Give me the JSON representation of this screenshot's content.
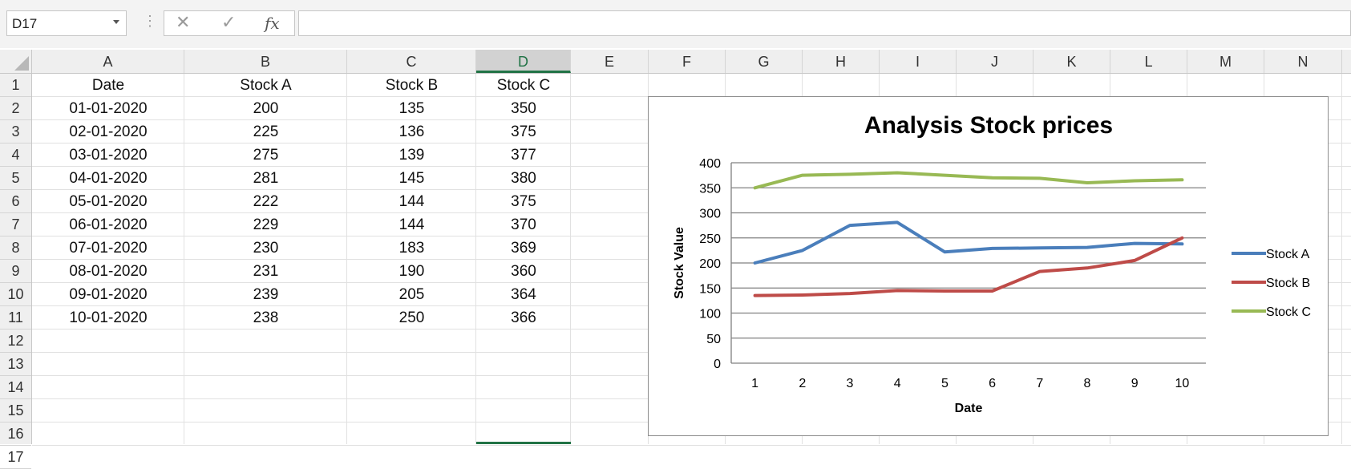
{
  "namebox": {
    "value": "D17"
  },
  "formula_bar": {
    "value": ""
  },
  "icons": {
    "cancel": "close-icon",
    "enter": "check-icon",
    "fx": "function-icon",
    "dropdown": "chevron-down-icon"
  },
  "colors": {
    "accent": "#217346",
    "stock_a": "#4a7ebb",
    "stock_b": "#be4b48",
    "stock_c": "#98b954"
  },
  "column_headers": [
    "A",
    "B",
    "C",
    "D",
    "E",
    "F",
    "G",
    "H",
    "I",
    "J",
    "K",
    "L",
    "M",
    "N"
  ],
  "row_headers": [
    "1",
    "2",
    "3",
    "4",
    "5",
    "6",
    "7",
    "8",
    "9",
    "10",
    "11",
    "12",
    "13",
    "14",
    "15",
    "16",
    "17"
  ],
  "table": {
    "headers": [
      "Date",
      "Stock A",
      "Stock B",
      "Stock C"
    ],
    "rows": [
      [
        "01-01-2020",
        "200",
        "135",
        "350"
      ],
      [
        "02-01-2020",
        "225",
        "136",
        "375"
      ],
      [
        "03-01-2020",
        "275",
        "139",
        "377"
      ],
      [
        "04-01-2020",
        "281",
        "145",
        "380"
      ],
      [
        "05-01-2020",
        "222",
        "144",
        "375"
      ],
      [
        "06-01-2020",
        "229",
        "144",
        "370"
      ],
      [
        "07-01-2020",
        "230",
        "183",
        "369"
      ],
      [
        "08-01-2020",
        "231",
        "190",
        "360"
      ],
      [
        "09-01-2020",
        "239",
        "205",
        "364"
      ],
      [
        "10-01-2020",
        "238",
        "250",
        "366"
      ]
    ]
  },
  "chart_data": {
    "type": "line",
    "title": "Analysis Stock prices",
    "xlabel": "Date",
    "ylabel": "Stock Value",
    "x": [
      1,
      2,
      3,
      4,
      5,
      6,
      7,
      8,
      9,
      10
    ],
    "ylim": [
      0,
      400
    ],
    "yticks": [
      0,
      50,
      100,
      150,
      200,
      250,
      300,
      350,
      400
    ],
    "grid": true,
    "legend": "right",
    "series": [
      {
        "name": "Stock A",
        "color": "#4a7ebb",
        "values": [
          200,
          225,
          275,
          281,
          222,
          229,
          230,
          231,
          239,
          238
        ]
      },
      {
        "name": "Stock B",
        "color": "#be4b48",
        "values": [
          135,
          136,
          139,
          145,
          144,
          144,
          183,
          190,
          205,
          250
        ]
      },
      {
        "name": "Stock C",
        "color": "#98b954",
        "values": [
          350,
          375,
          377,
          380,
          375,
          370,
          369,
          360,
          364,
          366
        ]
      }
    ]
  }
}
